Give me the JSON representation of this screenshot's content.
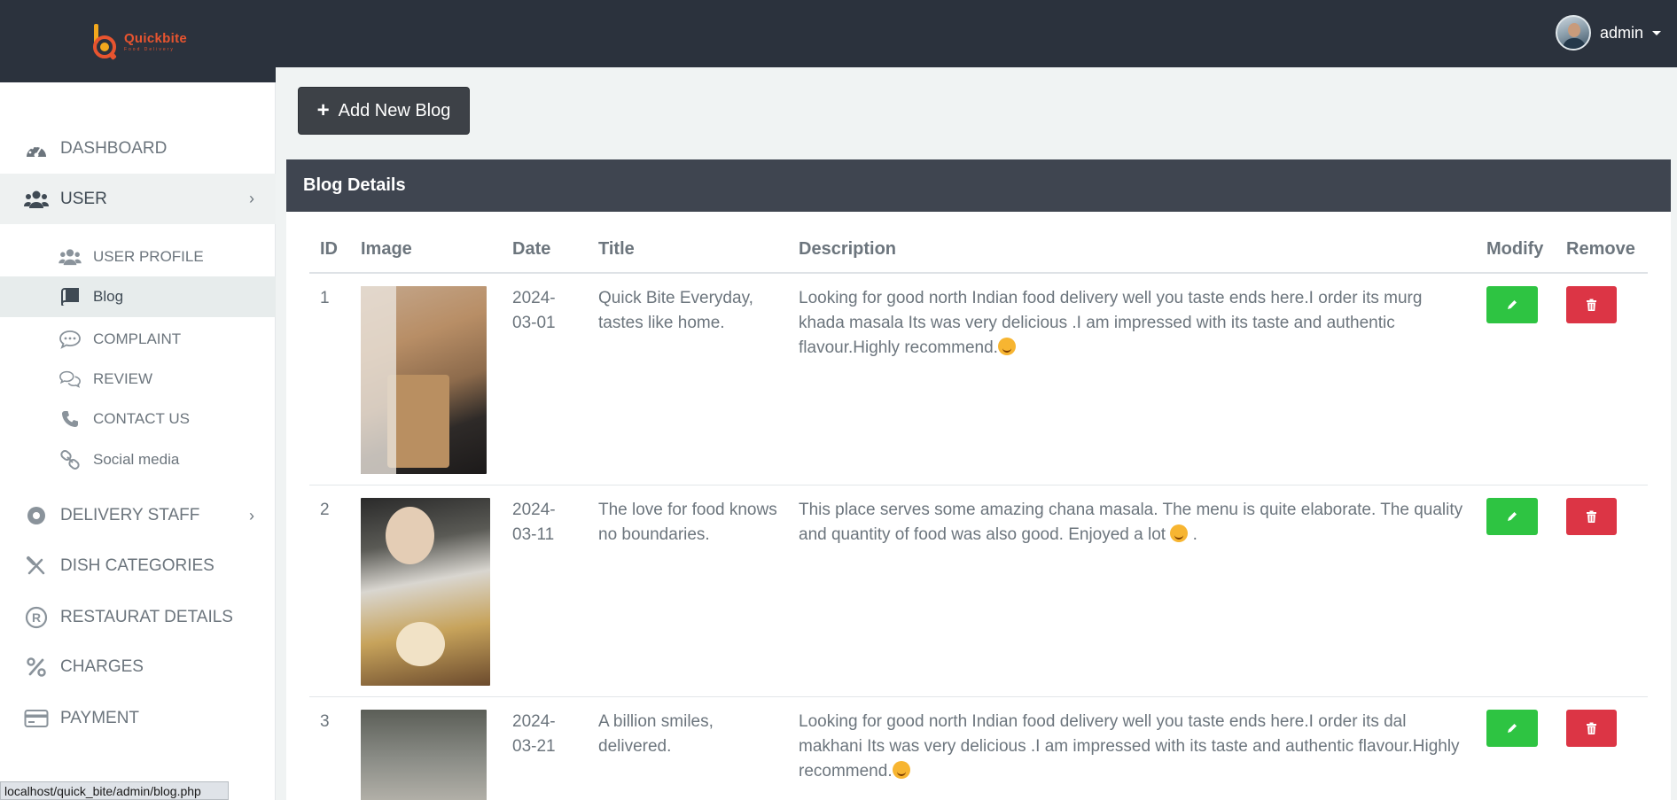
{
  "app": {
    "brand": "Quickbite",
    "tagline": "Food Delivery",
    "user": "admin"
  },
  "sidebar": {
    "items": [
      {
        "label": "DASHBOARD",
        "icon": "dashboard-gauge-icon"
      },
      {
        "label": "USER",
        "icon": "users-icon",
        "active": true
      },
      {
        "label": "USER PROFILE",
        "icon": "users-icon"
      },
      {
        "label": "Blog",
        "icon": "book-icon",
        "active": true
      },
      {
        "label": "COMPLAINT",
        "icon": "comment-dots-icon"
      },
      {
        "label": "REVIEW",
        "icon": "comments-icon"
      },
      {
        "label": "CONTACT US",
        "icon": "phone-icon"
      },
      {
        "label": "Social media",
        "icon": "link-icon"
      },
      {
        "label": "DELIVERY STAFF",
        "icon": "record-circle-icon"
      },
      {
        "label": "DISH CATEGORIES",
        "icon": "utensils-icon"
      },
      {
        "label": "RESTAURAT DETAILS",
        "icon": "registered-icon"
      },
      {
        "label": "CHARGES",
        "icon": "percent-icon"
      },
      {
        "label": "PAYMENT",
        "icon": "credit-card-icon"
      }
    ]
  },
  "toolbar": {
    "add_label": "Add New Blog"
  },
  "card": {
    "title": "Blog Details"
  },
  "table": {
    "headers": [
      "ID",
      "Image",
      "Date",
      "Title",
      "Description",
      "Modify",
      "Remove"
    ],
    "rows": [
      {
        "id": "1",
        "date": "2024-03-01",
        "title": "Quick Bite Everyday, tastes like home.",
        "description": "Looking for good north Indian food delivery well you taste ends here.I order its murg khada masala Its was very delicious .I am impressed with its taste and authentic flavour.Highly recommend."
      },
      {
        "id": "2",
        "date": "2024-03-11",
        "title": "The love for food knows no boundaries.",
        "description": "This place serves some amazing chana masala. The menu is quite elaborate. The quality and quantity of food was also good. Enjoyed a lot"
      },
      {
        "id": "3",
        "date": "2024-03-21",
        "title": "A billion smiles, delivered.",
        "description": "Looking for good north Indian food delivery well you taste ends here.I order its dal makhani Its was very delicious .I am impressed with its taste and authentic flavour.Highly recommend."
      }
    ]
  },
  "status_bar": {
    "url": "localhost/quick_bite/admin/blog.php"
  },
  "colors": {
    "topbar": "#2b323d",
    "modify": "#2ec442",
    "remove": "#dc3545",
    "brand": "#e8542f"
  }
}
